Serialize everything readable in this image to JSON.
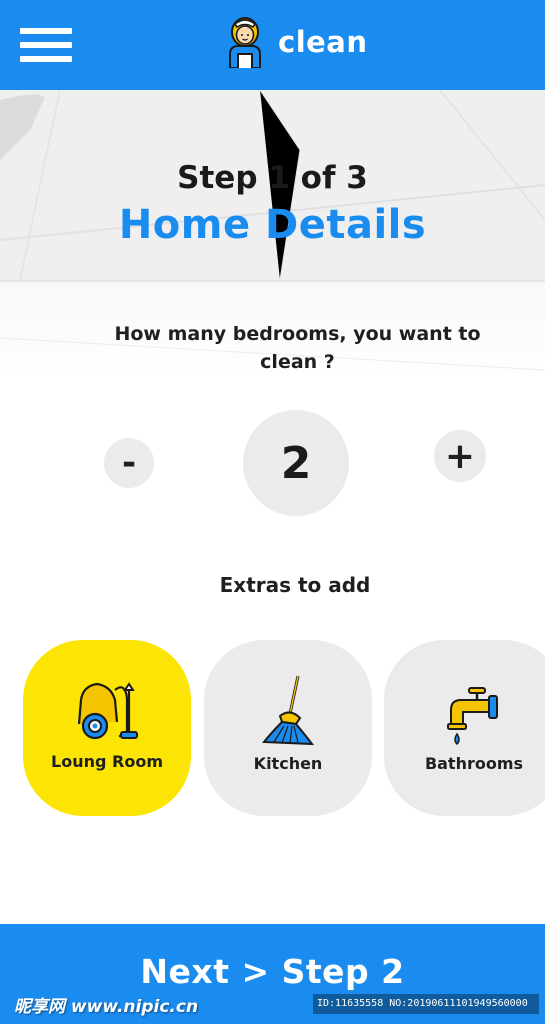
{
  "app": {
    "name": "clean",
    "accent_color": "#1a8cf0",
    "highlight_color": "#fce404",
    "menu_icon": "hamburger-menu-icon",
    "logo_icon": "cleaning-maid-icon"
  },
  "header": {
    "step_label": "Step 1 of 3",
    "title": "Home Details"
  },
  "bedrooms": {
    "question": "How many bedrooms, you want to clean ?",
    "minus_label": "-",
    "value": "2",
    "plus_label": "+"
  },
  "extras": {
    "title": "Extras to add",
    "items": [
      {
        "label": "Loung Room",
        "icon": "vacuum-cleaner-icon",
        "selected": true
      },
      {
        "label": "Kitchen",
        "icon": "broom-icon",
        "selected": false
      },
      {
        "label": "Bathrooms",
        "icon": "water-tap-icon",
        "selected": false
      }
    ]
  },
  "footer": {
    "next_label": "Next > Step 2"
  },
  "watermark": {
    "site": "昵享网 www.nipic.cn",
    "id_text": "ID:11635558 NO:20190611101949560000"
  }
}
